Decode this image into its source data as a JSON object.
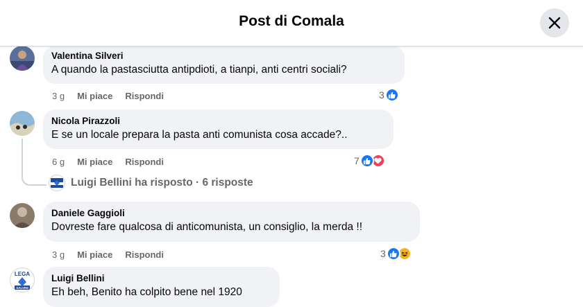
{
  "header": {
    "title": "Post di Comala"
  },
  "comments": [
    {
      "author": "Valentina Silveri",
      "text": "A quando la pastasciutta antipdioti, a tianpi, anti centri sociali?",
      "time": "3 g",
      "like_label": "Mi piace",
      "reply_label": "Rispondi",
      "reaction_count": "3",
      "reactions": [
        "like-icon"
      ]
    },
    {
      "author": "Nicola Pirazzoli",
      "text": "E se un locale prepara la pasta anti comunista cosa accade?..",
      "time": "6 g",
      "like_label": "Mi piace",
      "reply_label": "Rispondi",
      "reaction_count": "7",
      "reactions": [
        "like-icon",
        "love-icon"
      ],
      "replies_summary": "Luigi Bellini ha risposto · 6 risposte"
    },
    {
      "author": "Daniele Gaggioli",
      "text": "Dovreste fare qualcosa di anticomunista, un consiglio, la merda !!",
      "time": "3 g",
      "like_label": "Mi piace",
      "reply_label": "Rispondi",
      "reaction_count": "3",
      "reactions": [
        "like-icon",
        "haha-icon"
      ]
    },
    {
      "author": "Luigi Bellini",
      "text": "Eh beh, Benito ha colpito bene nel 1920"
    }
  ],
  "logo_text": {
    "top": "LEGA",
    "bottom": "SALVINI"
  },
  "colors": {
    "like": "#1877f2",
    "love": "#f33e58",
    "haha": "#f7b125",
    "bubble": "#f0f2f5"
  }
}
